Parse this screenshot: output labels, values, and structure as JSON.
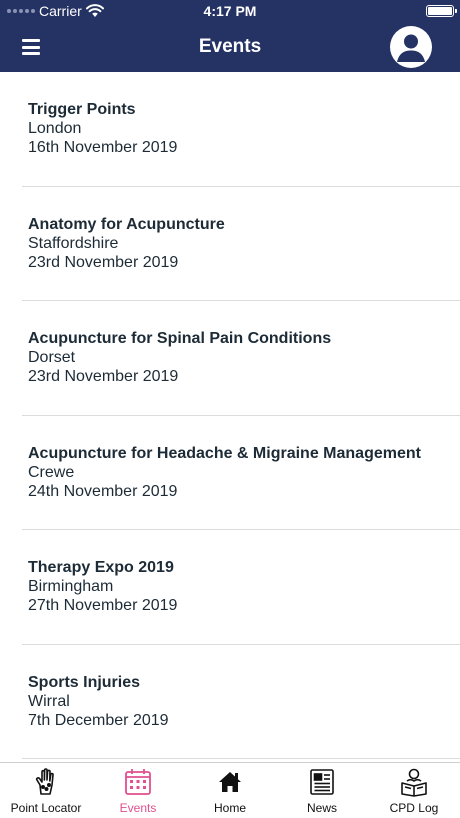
{
  "status_bar": {
    "carrier": "Carrier",
    "time": "4:17 PM"
  },
  "header": {
    "title": "Events",
    "menu_icon": "hamburger-menu-icon",
    "profile_icon": "user-avatar-icon",
    "background": "#253264"
  },
  "events": [
    {
      "title": "Trigger Points",
      "location": "London",
      "date": "16th November 2019"
    },
    {
      "title": "Anatomy for Acupuncture",
      "location": "Staffordshire",
      "date": "23rd November 2019"
    },
    {
      "title": "Acupuncture for Spinal Pain Conditions",
      "location": "Dorset",
      "date": "23rd November 2019"
    },
    {
      "title": "Acupuncture for Headache & Migraine Management",
      "location": "Crewe",
      "date": "24th November 2019"
    },
    {
      "title": "Therapy Expo 2019",
      "location": "Birmingham",
      "date": "27th November 2019"
    },
    {
      "title": "Sports Injuries",
      "location": "Wirral",
      "date": "7th December 2019"
    }
  ],
  "tab_bar": {
    "active_color": "#e04f8f",
    "tabs": [
      {
        "label": "Point Locator",
        "icon": "hand-points-icon",
        "active": false
      },
      {
        "label": "Events",
        "icon": "calendar-icon",
        "active": true
      },
      {
        "label": "Home",
        "icon": "home-icon",
        "active": false
      },
      {
        "label": "News",
        "icon": "newspaper-icon",
        "active": false
      },
      {
        "label": "CPD Log",
        "icon": "person-reading-icon",
        "active": false
      }
    ]
  }
}
